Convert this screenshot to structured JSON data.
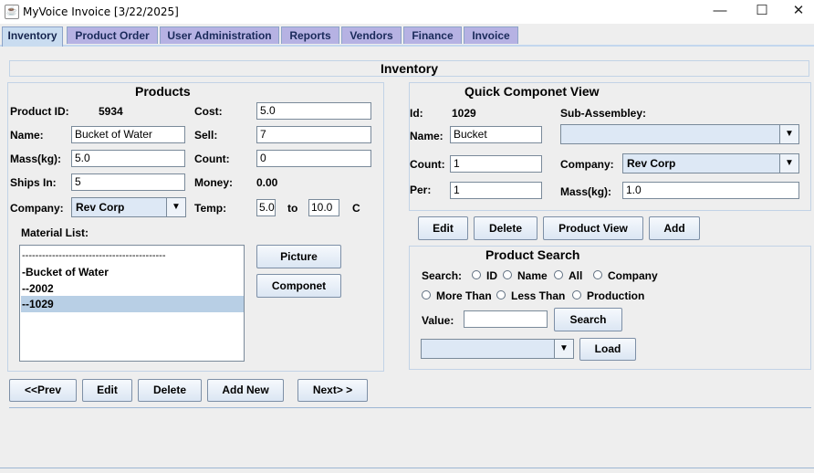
{
  "window": {
    "title": "MyVoice Invoice  [3/22/2025]",
    "controls": {
      "minimize": "—",
      "maximize": "☐",
      "close": "✕"
    }
  },
  "tabs": [
    "Inventory",
    "Product Order",
    "User Administration",
    "Reports",
    "Vendors",
    "Finance",
    "Invoice"
  ],
  "inventory": {
    "title": "Inventory"
  },
  "products": {
    "title": "Products",
    "product_id_label": "Product ID:",
    "product_id": "5934",
    "cost_label": "Cost:",
    "cost": "5.0",
    "name_label": "Name:",
    "name": "Bucket of Water",
    "sell_label": "Sell:",
    "sell": "7",
    "mass_label": "Mass(kg):",
    "mass": "5.0",
    "count_label": "Count:",
    "count": "0",
    "ships_label": "Ships In:",
    "ships": "5",
    "money_label": "Money:",
    "money": "0.00",
    "company_label": "Company:",
    "company": "Rev Corp",
    "temp_label": "Temp:",
    "temp_from": "5.0",
    "temp_to_label": "to",
    "temp_to": "10.0",
    "temp_unit": "C",
    "material_label": "Material List:",
    "material_items": [
      "-------------------------------------------",
      "-Bucket of Water",
      "--2002",
      "--1029"
    ],
    "selected_item_index": 3,
    "picture_button": "Picture",
    "componet_button": "Componet",
    "prev_button": "<<Prev",
    "edit_button": "Edit",
    "delete_button": "Delete",
    "add_new_button": "Add New",
    "next_button": "Next> >"
  },
  "quick_view": {
    "title": "Quick Componet View",
    "id_label": "Id:",
    "id": "1029",
    "sub_label": "Sub-Assembley:",
    "sub_value": "",
    "name_label": "Name:",
    "name": "Bucket",
    "count_label": "Count:",
    "count": "1",
    "company_label": "Company:",
    "company": "Rev Corp",
    "per_label": "Per:",
    "per": "1",
    "mass_label": "Mass(kg):",
    "mass": "1.0",
    "edit_button": "Edit",
    "delete_button": "Delete",
    "product_view_button": "Product View",
    "add_button": "Add"
  },
  "search": {
    "title": "Product Search",
    "search_label": "Search:",
    "options": [
      "ID",
      "Name",
      "All",
      "Company",
      "More Than",
      "Less Than",
      "Production"
    ],
    "value_label": "Value:",
    "value": "",
    "search_button": "Search",
    "load_button": "Load",
    "dropdown_value": ""
  },
  "icons": {
    "dropdown": "▼",
    "app": "☕"
  }
}
